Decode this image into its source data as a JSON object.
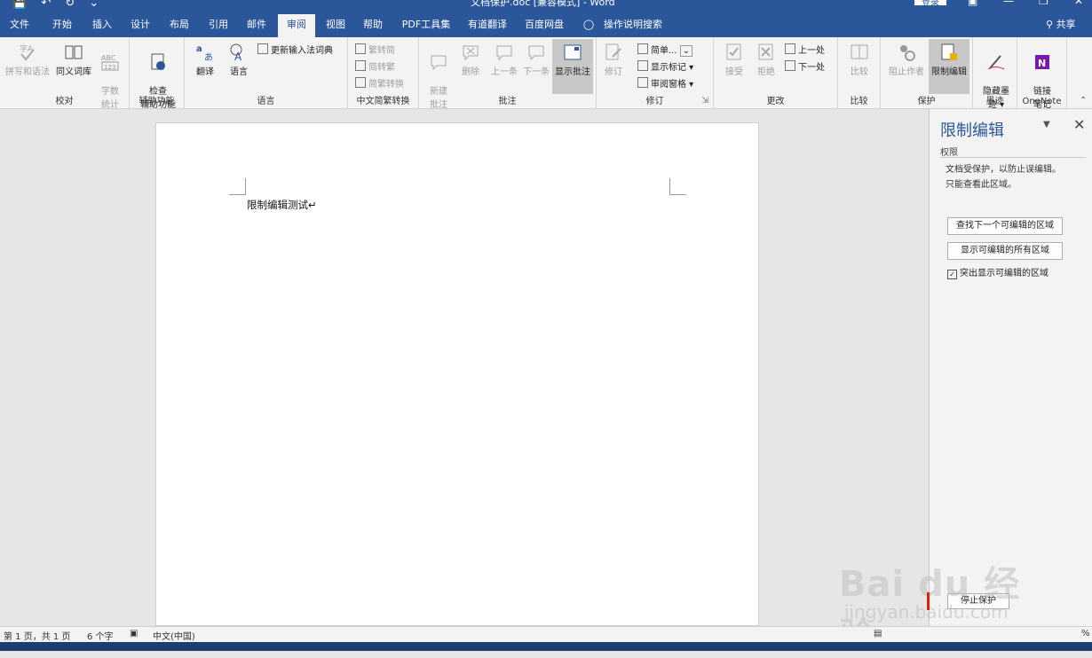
{
  "titlebar": {
    "quick_access": [
      "💾",
      "↶",
      "↻",
      "⌄"
    ],
    "doc_title": "文档保护.doc [兼容模式] - Word",
    "login_label": "登录",
    "window_controls": [
      "▣",
      "—",
      "❐",
      "✕"
    ]
  },
  "tabs": [
    {
      "label": "文件",
      "active": false
    },
    {
      "label": "开始",
      "active": false
    },
    {
      "label": "插入",
      "active": false
    },
    {
      "label": "设计",
      "active": false
    },
    {
      "label": "布局",
      "active": false
    },
    {
      "label": "引用",
      "active": false
    },
    {
      "label": "邮件",
      "active": false
    },
    {
      "label": "审阅",
      "active": true
    },
    {
      "label": "视图",
      "active": false
    },
    {
      "label": "帮助",
      "active": false
    },
    {
      "label": "PDF工具集",
      "active": false
    },
    {
      "label": "有道翻译",
      "active": false
    },
    {
      "label": "百度网盘",
      "active": false
    },
    {
      "label": "操作说明搜索",
      "active": false
    }
  ],
  "tell_me_icon": "lightbulb-icon",
  "share_label": "共享",
  "ribbon": {
    "proofing": {
      "label": "校对",
      "spelling": "拼写和语法",
      "thesaurus": "同义词库",
      "wordcount": "字数\n统计"
    },
    "accessibility": {
      "label": "辅助功能",
      "check": "检查\n辅助功能"
    },
    "language": {
      "label": "语言",
      "translate": "翻译",
      "language": "语言",
      "update_ime": "更新输入法词典"
    },
    "chinese": {
      "label": "中文简繁转换",
      "to_simplified": "繁转简",
      "to_traditional": "简转繁",
      "convert": "简繁转换"
    },
    "comments": {
      "label": "批注",
      "new": "新建\n批注",
      "delete": "删除",
      "prev": "上一条",
      "next": "下一条",
      "show": "显示批注"
    },
    "tracking": {
      "label": "修订",
      "track": "修订",
      "simple": "简单...",
      "show_markup": "显示标记 ▾",
      "review_pane": "审阅窗格 ▾"
    },
    "changes": {
      "label": "更改",
      "accept": "接受",
      "reject": "拒绝",
      "prev": "上一处",
      "next": "下一处"
    },
    "compare": {
      "label": "比较",
      "compare": "比较"
    },
    "protect": {
      "label": "保护",
      "block_authors": "阻止作者",
      "restrict_editing": "限制编辑"
    },
    "ink": {
      "label": "墨迹",
      "hide_ink": "隐藏墨\n迹 ▾"
    },
    "onenote": {
      "label": "OneNote",
      "linked_notes": "链接\n笔记"
    }
  },
  "document": {
    "text": "限制编辑测试↵"
  },
  "pane": {
    "title": "限制编辑",
    "section": "权限",
    "desc1": "文档受保护，以防止误编辑。",
    "desc2": "只能查看此区域。",
    "find_next": "查找下一个可编辑的区域",
    "show_all": "显示可编辑的所有区域",
    "highlight_label": "突出显示可编辑的区域",
    "highlight_checked": true,
    "stop_label": "停止保护"
  },
  "status": {
    "page": "第 1 页，共 1 页",
    "words": "6 个字",
    "lang": "中文(中国)",
    "zoom": "%"
  },
  "watermark": {
    "brand": "Bai du 经验",
    "url": "jingyan.baidu.com"
  }
}
